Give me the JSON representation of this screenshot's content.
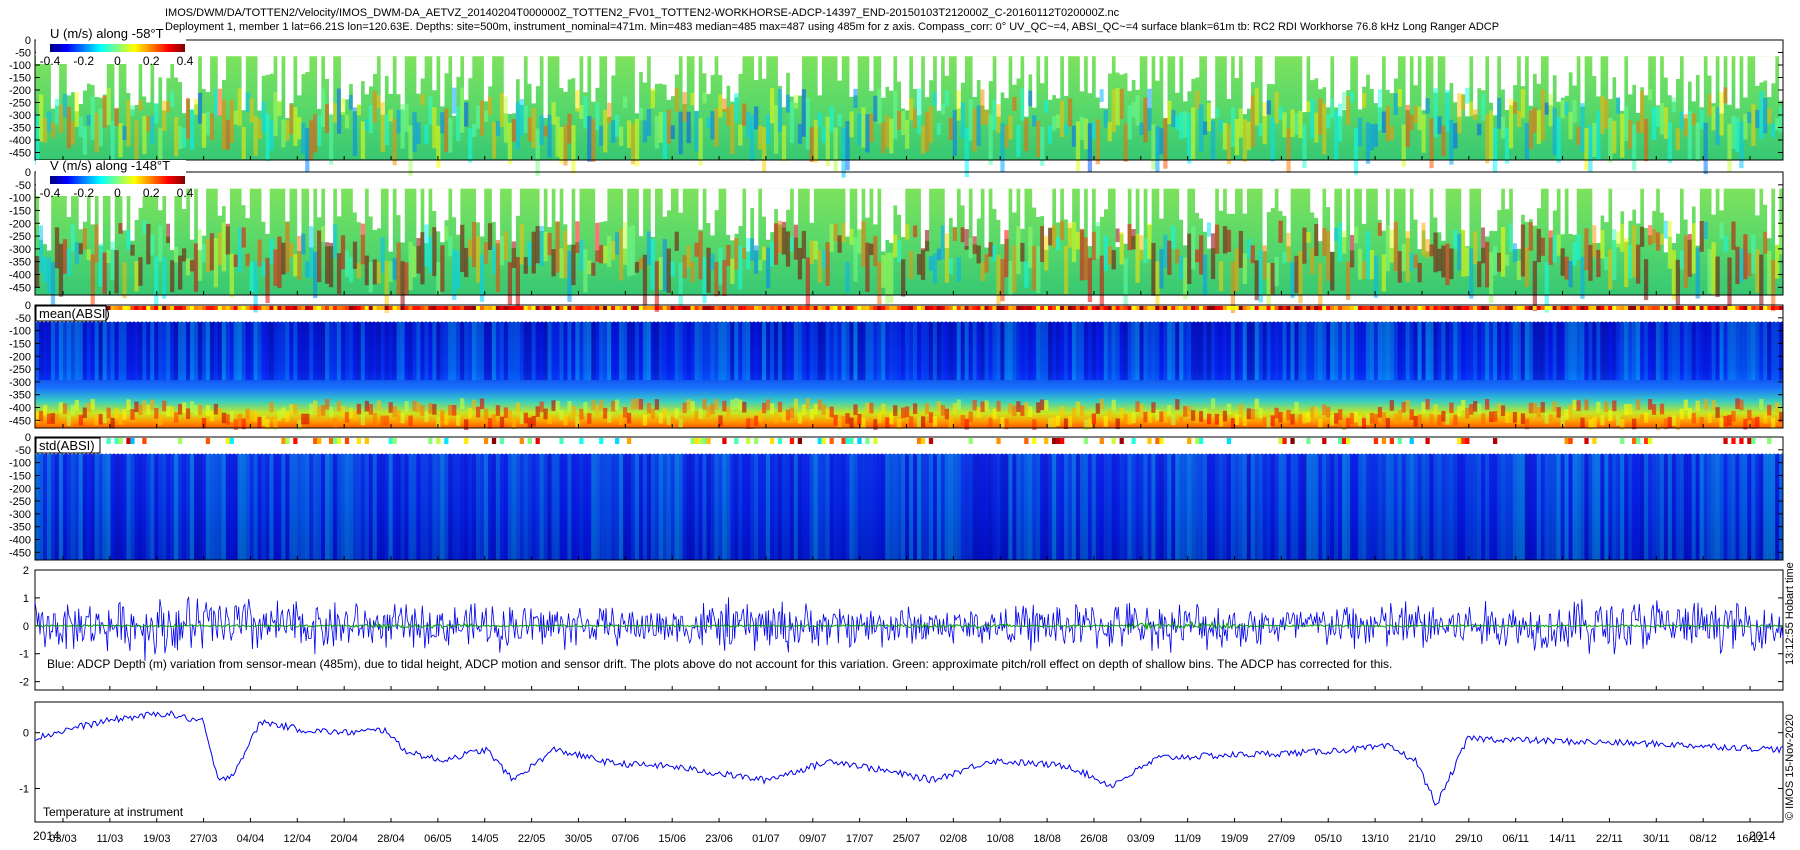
{
  "header": {
    "line1": "IMOS/DWM/DA/TOTTEN2/Velocity/IMOS_DWM-DA_AETVZ_20140204T000000Z_TOTTEN2_FV01_TOTTEN2-WORKHORSE-ADCP-14397_END-20150103T212000Z_C-20160112T020000Z.nc",
    "line2": "Deployment 1, member 1 lat=66.21S lon=120.63E. Depths: site=500m, instrument_nominal=471m. Min=483 median=485 max=487 using 485m for z axis. Compass_corr: 0° UV_QC~=4, ABSI_QC~=4 surface blank=61m tb: RC2 RDI Workhorse 76.8 kHz Long Ranger ADCP"
  },
  "stamps": {
    "right_upper": "13:12:55 Hobart time",
    "right_lower": "© IMOS 15-Nov-2020"
  },
  "colors": {
    "line_blue": "#0000ee",
    "line_green": "#00a000",
    "jet": [
      "#000080",
      "#0000ff",
      "#0080ff",
      "#00ffff",
      "#80ff80",
      "#ffff00",
      "#ff8000",
      "#ff0000",
      "#800000"
    ]
  },
  "chart_data": [
    {
      "type": "heatmap",
      "title": "U (m/s) along -58°T",
      "colorbar_ticks": [
        "-0.4",
        "-0.2",
        "0",
        "0.2",
        "0.4"
      ],
      "clim": [
        -0.4,
        0.4
      ],
      "ylim": [
        -480,
        0
      ],
      "yticks": [
        0,
        -50,
        -100,
        -150,
        -200,
        -250,
        -300,
        -350,
        -400,
        -450
      ],
      "values": [
        0.03,
        0.04,
        0.02,
        0.05,
        0.03,
        0.04,
        0.02,
        0.06,
        0.03,
        0.02,
        0.04,
        0.05,
        0.03,
        0.02,
        0.03,
        0.04,
        0.02,
        0.03,
        0.01,
        0.02,
        0.03,
        0.05,
        0.04,
        0.02,
        0.03,
        0.04,
        0.05,
        0.03,
        0.02,
        0.04,
        0.03,
        0.05,
        0.06,
        0.03,
        0.02,
        0.04,
        0.03,
        0.05,
        0.02,
        0.03
      ]
    },
    {
      "type": "heatmap",
      "title": "V (m/s) along -148°T",
      "colorbar_ticks": [
        "-0.4",
        "-0.2",
        "0",
        "0.2",
        "0.4"
      ],
      "clim": [
        -0.4,
        0.4
      ],
      "ylim": [
        -480,
        0
      ],
      "yticks": [
        0,
        -50,
        -100,
        -150,
        -200,
        -250,
        -300,
        -350,
        -400,
        -450
      ],
      "values": [
        0.08,
        0.12,
        0.1,
        0.09,
        0.14,
        0.11,
        0.07,
        0.12,
        0.1,
        0.15,
        0.09,
        0.08,
        0.11,
        0.07,
        0.13,
        0.1,
        0.06,
        0.09,
        0.1,
        0.12,
        0.08,
        0.11,
        0.07,
        0.1,
        0.09,
        0.12,
        0.08,
        0.1,
        0.11,
        0.09,
        0.14,
        0.1,
        0.08,
        0.12,
        0.09,
        0.11,
        0.13,
        0.1,
        0.12,
        0.09
      ]
    },
    {
      "type": "heatmap",
      "title": "mean(ABSI)",
      "ylim": [
        -480,
        0
      ],
      "yticks": [
        0,
        -50,
        -100,
        -150,
        -200,
        -250,
        -300,
        -350,
        -400,
        -450
      ],
      "values": [
        0.2,
        0.2,
        0.22,
        0.2,
        0.24,
        0.25,
        0.24,
        0.24,
        0.22,
        0.24,
        0.22,
        0.24,
        0.23,
        0.22,
        0.24,
        0.22,
        0.25,
        0.24,
        0.24,
        0.24,
        0.22,
        0.25,
        0.24,
        0.22,
        0.24,
        0.22,
        0.23,
        0.24,
        0.24,
        0.25,
        0.24,
        0.22,
        0.24,
        0.24,
        0.22,
        0.25,
        0.24,
        0.23,
        0.22,
        0.22
      ]
    },
    {
      "type": "heatmap",
      "title": "std(ABSI)",
      "ylim": [
        -480,
        0
      ],
      "yticks": [
        0,
        -50,
        -100,
        -150,
        -200,
        -250,
        -300,
        -350,
        -400,
        -450
      ],
      "values": [
        0.16,
        0.18,
        0.17,
        0.2,
        0.18,
        0.16,
        0.17,
        0.16,
        0.2,
        0.18,
        0.17,
        0.16,
        0.18,
        0.2,
        0.18,
        0.17,
        0.16,
        0.18,
        0.16,
        0.18,
        0.17,
        0.16,
        0.18,
        0.2,
        0.17,
        0.16,
        0.18,
        0.17,
        0.16,
        0.18,
        0.17,
        0.16,
        0.18,
        0.16,
        0.17,
        0.16,
        0.18,
        0.17,
        0.16,
        0.18
      ]
    },
    {
      "type": "line",
      "annotation": "Blue: ADCP Depth (m) variation from sensor-mean (485m), due to tidal height, ADCP motion and sensor drift. The plots above do not account for this variation. Green: approximate pitch/roll effect on depth of shallow bins. The ADCP has corrected for this.",
      "ylim": [
        -2.3,
        2
      ],
      "yticks": [
        2,
        1,
        0,
        -1,
        -2
      ],
      "series": [
        {
          "color": "#0000ee",
          "amplitude": [
            1.0,
            1.3,
            1.1,
            0.9,
            1.0,
            0.8,
            1.1,
            0.9,
            0.8,
            1.0,
            1.0,
            0.9,
            1.1,
            1.0,
            1.2,
            1.0
          ]
        },
        {
          "color": "#00a000",
          "amplitude": [
            0.05,
            0.05,
            0.05,
            0.1,
            0.05,
            0.05,
            0.05,
            0.05,
            0.1,
            0.05,
            0.15,
            0.05,
            0.05,
            0.05,
            0.05,
            0.05
          ]
        }
      ]
    },
    {
      "type": "line",
      "annotation": "Temperature at instrument",
      "ylim": [
        -1.6,
        0.55
      ],
      "yticks": [
        0,
        -1
      ],
      "x": [
        "2014-02-04",
        "2014-02-12",
        "2014-02-20",
        "2014-03-01",
        "2014-03-03",
        "2014-03-08",
        "2014-03-11",
        "2014-03-14",
        "2014-03-19",
        "2014-03-27",
        "2014-04-04",
        "2014-04-12",
        "2014-04-15",
        "2014-04-22",
        "2014-05-01",
        "2014-05-06",
        "2014-05-14",
        "2014-05-25",
        "2014-06-05",
        "2014-06-23",
        "2014-07-06",
        "2014-07-25",
        "2014-08-05",
        "2014-08-20",
        "2014-08-28",
        "2014-09-06",
        "2014-09-20",
        "2014-10-05",
        "2014-10-20",
        "2014-10-25",
        "2014-10-29",
        "2014-11-04",
        "2014-11-20",
        "2014-12-10",
        "2015-01-03"
      ],
      "y": [
        -0.1,
        0.1,
        0.25,
        0.35,
        0.3,
        0.2,
        -0.9,
        -0.7,
        0.2,
        0.05,
        0.0,
        0.05,
        -0.3,
        -0.5,
        -0.3,
        -0.85,
        -0.3,
        -0.55,
        -0.6,
        -0.85,
        -0.5,
        -0.85,
        -0.5,
        -0.6,
        -0.95,
        -0.45,
        -0.4,
        -0.35,
        -0.25,
        -0.5,
        -1.3,
        -0.1,
        -0.15,
        -0.2,
        -0.3
      ]
    }
  ],
  "xaxis": {
    "year_left": "2014",
    "year_right": "2014",
    "ticks": [
      "03/03",
      "11/03",
      "19/03",
      "27/03",
      "04/04",
      "12/04",
      "20/04",
      "28/04",
      "06/05",
      "14/05",
      "22/05",
      "30/05",
      "07/06",
      "15/06",
      "23/06",
      "01/07",
      "09/07",
      "17/07",
      "25/07",
      "02/08",
      "10/08",
      "18/08",
      "26/08",
      "03/09",
      "11/09",
      "19/09",
      "27/09",
      "05/10",
      "13/10",
      "21/10",
      "29/10",
      "06/11",
      "14/11",
      "22/11",
      "30/11",
      "08/12",
      "16/12"
    ]
  }
}
